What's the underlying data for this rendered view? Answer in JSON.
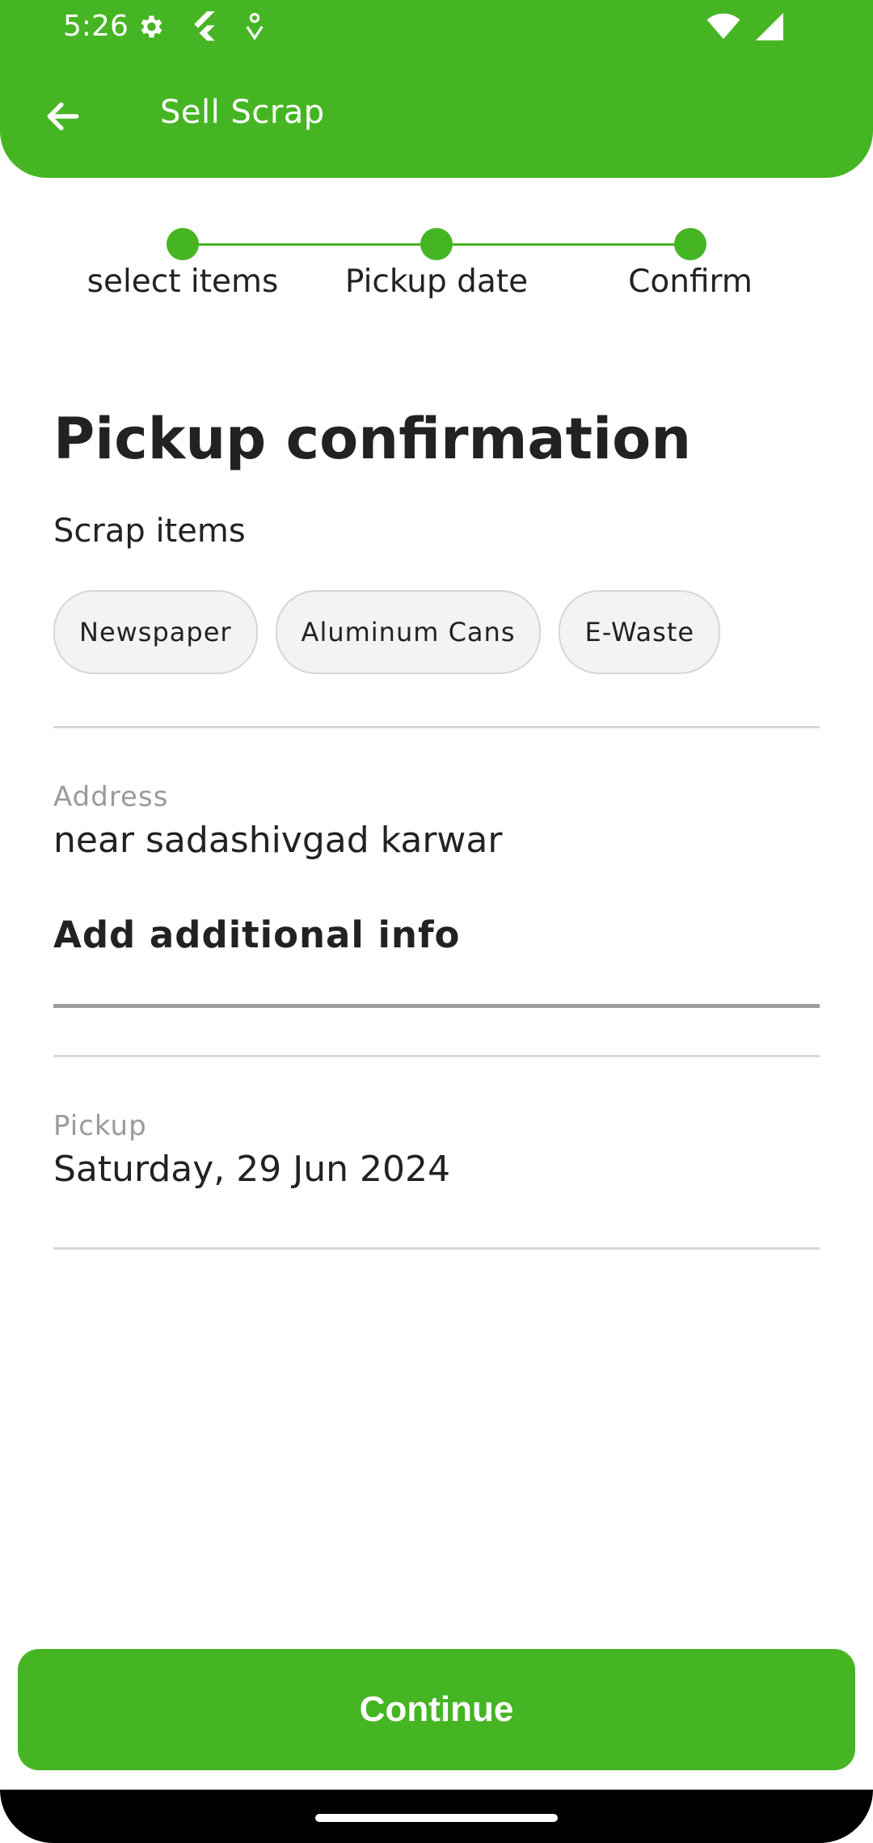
{
  "status_bar": {
    "time": "5:26",
    "icons": [
      "gear-icon",
      "flutter-icon",
      "debug-icon"
    ],
    "right_icons": [
      "wifi-icon",
      "signal-icon"
    ]
  },
  "app_bar": {
    "back_icon": "arrow-left-icon",
    "title": "Sell Scrap",
    "color": "#46b523"
  },
  "stepper": {
    "steps": [
      {
        "label": "select items"
      },
      {
        "label": "Pickup date"
      },
      {
        "label": "Confirm"
      }
    ]
  },
  "main": {
    "heading": "Pickup confirmation",
    "scrap_items_label": "Scrap items",
    "chips": [
      "Newspaper",
      "Aluminum Cans",
      "E-Waste"
    ],
    "address": {
      "caption": "Address",
      "value": "near sadashivgad karwar"
    },
    "additional_info": {
      "label": "Add additional info"
    },
    "pickup": {
      "caption": "Pickup",
      "value": "Saturday, 29 Jun 2024"
    }
  },
  "footer": {
    "continue_label": "Continue"
  }
}
